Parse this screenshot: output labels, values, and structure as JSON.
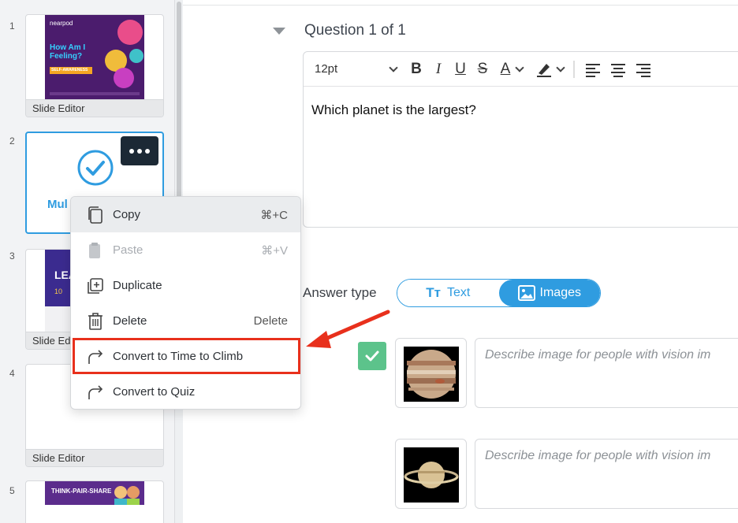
{
  "sidebar": {
    "slides": [
      {
        "number": "1",
        "label": "Slide Editor",
        "thumb_logo": "nearpod",
        "thumb_title": "How Am I Feeling?",
        "thumb_badge": "SELF-AWARENESS"
      },
      {
        "number": "2",
        "label": "Mul",
        "type": "Multiple Choice"
      },
      {
        "number": "3",
        "label": "Slide Ed",
        "thumb_title": "LEA",
        "thumb_sub": "10"
      },
      {
        "number": "4",
        "label": "Slide Editor"
      },
      {
        "number": "5",
        "thumb_title": "THINK-PAIR-SHARE"
      }
    ]
  },
  "question": {
    "title": "Question 1 of 1",
    "font_size": "12pt",
    "text": "Which planet is the largest?"
  },
  "answer_type": {
    "label": "Answer type",
    "options": [
      "Text",
      "Images"
    ],
    "selected": "Images"
  },
  "answers": [
    {
      "correct": true,
      "image": "jupiter",
      "placeholder": "Describe image for people with vision im"
    },
    {
      "correct": false,
      "image": "saturn",
      "placeholder": "Describe image for people with vision im"
    }
  ],
  "context_menu": {
    "items": [
      {
        "label": "Copy",
        "shortcut": "⌘+C",
        "icon": "copy-icon",
        "state": "hover"
      },
      {
        "label": "Paste",
        "shortcut": "⌘+V",
        "icon": "paste-icon",
        "state": "disabled"
      },
      {
        "label": "Duplicate",
        "shortcut": "",
        "icon": "duplicate-icon",
        "state": "normal"
      },
      {
        "label": "Delete",
        "shortcut": "Delete",
        "icon": "trash-icon",
        "state": "normal"
      },
      {
        "label": "Convert to Time to Climb",
        "shortcut": "",
        "icon": "convert-arrow-icon",
        "state": "highlighted"
      },
      {
        "label": "Convert to Quiz",
        "shortcut": "",
        "icon": "convert-arrow-icon",
        "state": "normal"
      }
    ]
  },
  "colors": {
    "accent": "#2f9ce0",
    "correct": "#5cc38b",
    "annotation": "#e8301c",
    "more_button": "#1c2935"
  }
}
